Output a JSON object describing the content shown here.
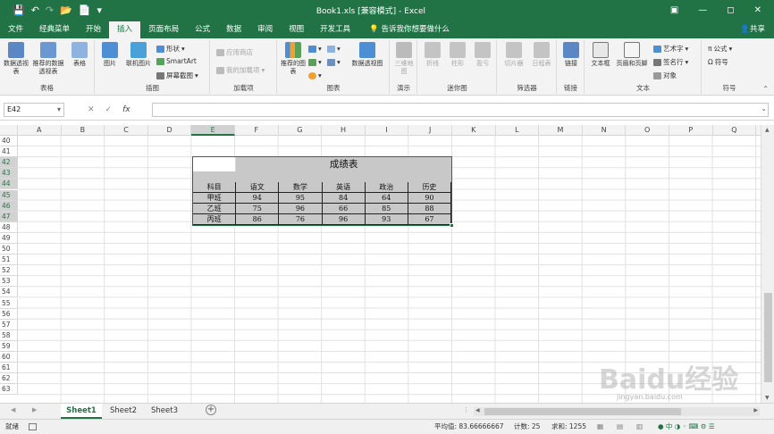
{
  "title": "Book1.xls  [兼容模式]  -  Excel",
  "quick_access": {
    "save_icon": "save-icon",
    "undo_icon": "undo-icon",
    "redo_icon": "redo-icon",
    "open_icon": "open-folder-icon",
    "new_icon": "new-file-icon",
    "more_icon": "chevron-down-icon"
  },
  "window": {
    "restore_icon": "ribbon-display-icon",
    "min": "—",
    "max": "◻",
    "close": "✕"
  },
  "tabs": [
    {
      "label": "文件"
    },
    {
      "label": "经典菜单"
    },
    {
      "label": "开始"
    },
    {
      "label": "插入"
    },
    {
      "label": "页面布局"
    },
    {
      "label": "公式"
    },
    {
      "label": "数据"
    },
    {
      "label": "审阅"
    },
    {
      "label": "视图"
    },
    {
      "label": "开发工具"
    }
  ],
  "tell_me": "告诉我你想要做什么",
  "share": "共享",
  "ribbon": {
    "groups": [
      {
        "label": "表格",
        "buttons": [
          "数据透视表",
          "推荐的数据透视表",
          "表格"
        ]
      },
      {
        "label": "插图",
        "buttons": [
          "图片",
          "联机图片"
        ],
        "small": [
          "形状",
          "SmartArt",
          "屏幕截图"
        ]
      },
      {
        "label": "加载项",
        "small": [
          "应用商店",
          "我的加载项"
        ]
      },
      {
        "label": "图表",
        "buttons": [
          "推荐的图表",
          "数据透视图"
        ]
      },
      {
        "label": "演示",
        "buttons": [
          "三维地图"
        ]
      },
      {
        "label": "迷你图",
        "buttons": [
          "折线",
          "柱形",
          "盈亏"
        ]
      },
      {
        "label": "筛选器",
        "buttons": [
          "切片器",
          "日程表"
        ]
      },
      {
        "label": "链接",
        "buttons": [
          "链接"
        ]
      },
      {
        "label": "文本",
        "buttons": [
          "文本框",
          "页眉和页脚"
        ],
        "small": [
          "艺术字",
          "签名行",
          "对象"
        ]
      },
      {
        "label": "符号",
        "small": [
          "公式",
          "符号"
        ]
      }
    ]
  },
  "name_box": "E42",
  "fx": "fx",
  "columns": [
    "A",
    "B",
    "C",
    "D",
    "E",
    "F",
    "G",
    "H",
    "I",
    "J",
    "K",
    "L",
    "M",
    "N",
    "O",
    "P",
    "Q"
  ],
  "rows": [
    "40",
    "41",
    "42",
    "43",
    "44",
    "45",
    "46",
    "47",
    "48",
    "49",
    "50",
    "51",
    "52",
    "53",
    "54",
    "55",
    "56",
    "57",
    "58",
    "59",
    "60",
    "61",
    "62",
    "63"
  ],
  "table": {
    "title": "成绩表",
    "headers": [
      "科目",
      "语文",
      "数学",
      "英语",
      "政治",
      "历史"
    ],
    "rows": [
      [
        "甲班",
        "94",
        "95",
        "84",
        "64",
        "90"
      ],
      [
        "乙班",
        "75",
        "96",
        "66",
        "85",
        "88"
      ],
      [
        "丙班",
        "86",
        "76",
        "96",
        "93",
        "67"
      ]
    ]
  },
  "sheets": [
    "Sheet1",
    "Sheet2",
    "Sheet3"
  ],
  "status": {
    "ready": "就绪",
    "average": "平均值: 83.66666667",
    "count": "计数: 25",
    "sum": "求和: 1255"
  },
  "watermark": "Baidu经验",
  "watermark_sub": "jingyan.baidu.com",
  "colors": {
    "brand": "#217346",
    "selection": "#d2d2d2",
    "table_fill": "#c8c8c8"
  }
}
